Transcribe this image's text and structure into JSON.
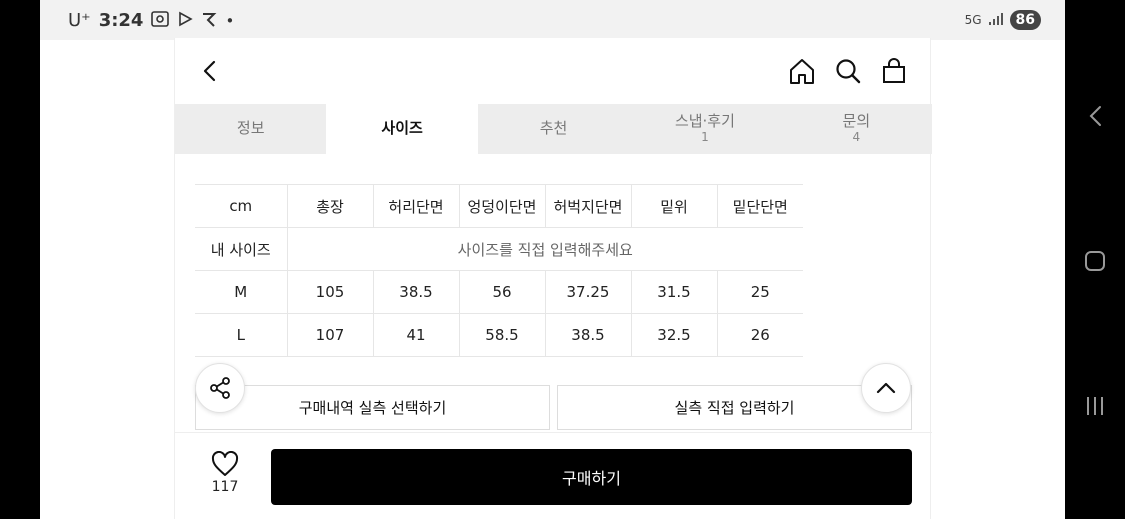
{
  "status_bar": {
    "carrier": "U⁺",
    "time": "3:24",
    "network": "5G",
    "battery": "86",
    "notification_icons": [
      "screenshot-icon",
      "play-icon",
      "app-icon",
      "dot-icon"
    ]
  },
  "header": {
    "back_icon": "chevron-left-icon",
    "home_icon": "home-icon",
    "search_icon": "search-icon",
    "cart_icon": "shopping-bag-icon"
  },
  "tabs": [
    {
      "label": "정보",
      "count": ""
    },
    {
      "label": "사이즈",
      "count": "",
      "active": true
    },
    {
      "label": "추천",
      "count": ""
    },
    {
      "label": "스냅·후기",
      "count": "1"
    },
    {
      "label": "문의",
      "count": "4"
    }
  ],
  "size_table": {
    "columns": [
      "cm",
      "총장",
      "허리단면",
      "엉덩이단면",
      "허벅지단면",
      "밑위",
      "밑단단면"
    ],
    "my_size_label": "내 사이즈",
    "my_size_prompt": "사이즈를 직접 입력해주세요",
    "rows": [
      {
        "size": "M",
        "values": [
          "105",
          "38.5",
          "56",
          "37.25",
          "31.5",
          "25"
        ]
      },
      {
        "size": "L",
        "values": [
          "107",
          "41",
          "58.5",
          "38.5",
          "32.5",
          "26"
        ]
      }
    ]
  },
  "actions": {
    "purchase_history_label": "구매내역 실측 선택하기",
    "manual_input_label": "실측 직접 입력하기"
  },
  "bottom_bar": {
    "like_count": "117",
    "buy_label": "구매하기"
  },
  "colors": {
    "active_tab_bg": "#ffffff",
    "tab_bar_bg": "#ededed",
    "buy_button_bg": "#000000"
  }
}
